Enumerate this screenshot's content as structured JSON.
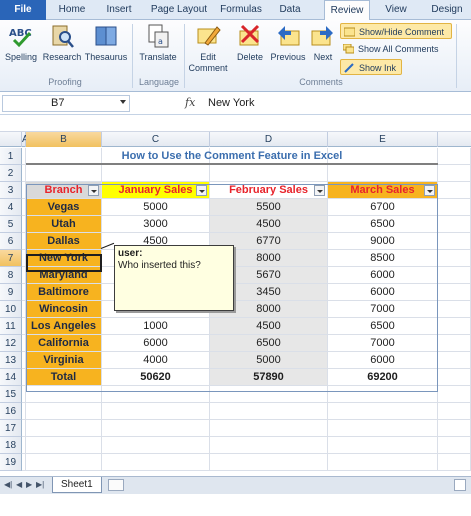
{
  "ribbon": {
    "tabs": [
      "File",
      "Home",
      "Insert",
      "Page Layout",
      "Formulas",
      "Data",
      "Review",
      "View",
      "Design"
    ],
    "active_tab": "Review",
    "buttons": {
      "spelling": "Spelling",
      "research": "Research",
      "thesaurus": "Thesaurus",
      "translate": "Translate",
      "edit_comment": "Edit Comment",
      "delete": "Delete",
      "previous": "Previous",
      "next": "Next",
      "show_hide_comment": "Show/Hide Comment",
      "show_all_comments": "Show All Comments",
      "show_ink": "Show Ink"
    },
    "groups": {
      "proofing": "Proofing",
      "language": "Language",
      "comments": "Comments"
    }
  },
  "formula_bar": {
    "name_box": "B7",
    "fx": "fx",
    "content": "New York"
  },
  "grid": {
    "columns": [
      "A",
      "B",
      "C",
      "D",
      "E"
    ],
    "rows": [
      "1",
      "2",
      "3",
      "4",
      "5",
      "6",
      "7",
      "8",
      "9",
      "10",
      "11",
      "12",
      "13",
      "14",
      "15",
      "16",
      "17",
      "18",
      "19"
    ],
    "title": "How to Use the Comment Feature in Excel",
    "headers": [
      "Branch",
      "January Sales",
      "February Sales",
      "March Sales"
    ],
    "data": [
      [
        "Vegas",
        "5000",
        "5500",
        "6700"
      ],
      [
        "Utah",
        "3000",
        "4500",
        "6500"
      ],
      [
        "Dallas",
        "4500",
        "6770",
        "9000"
      ],
      [
        "New York",
        "",
        "8000",
        "8500"
      ],
      [
        "Maryland",
        "",
        "5670",
        "6000"
      ],
      [
        "Baltimore",
        "",
        "3450",
        "6000"
      ],
      [
        "Wincosin",
        "9220",
        "8000",
        "7000"
      ],
      [
        "Los Angeles",
        "1000",
        "4500",
        "6500"
      ],
      [
        "California",
        "6000",
        "6500",
        "7000"
      ],
      [
        "Virginia",
        "4000",
        "5000",
        "6000"
      ]
    ],
    "totals": [
      "Total",
      "50620",
      "57890",
      "69200"
    ]
  },
  "comment": {
    "author": "user:",
    "text": "Who inserted this?"
  },
  "sheets": {
    "active": "Sheet1"
  },
  "colors": {
    "branch_fill": "#f7b31f",
    "title_blue": "#3b6eae",
    "header_red": "#e8232b",
    "header_yellow": "#ffff00",
    "header_orange": "#f7b31f",
    "comment_bg": "#ffffe1"
  }
}
